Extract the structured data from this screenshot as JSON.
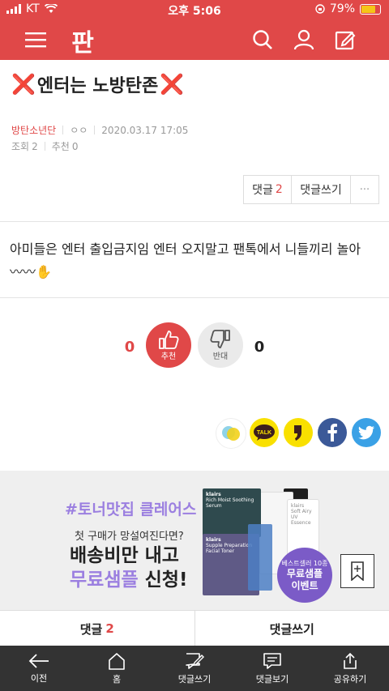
{
  "status_bar": {
    "carrier": "KT",
    "time": "오후 5:06",
    "battery": "79%",
    "battery_level": 0.79
  },
  "header": {
    "logo": "판",
    "icons": [
      "menu-icon",
      "search-icon",
      "user-icon",
      "write-icon"
    ]
  },
  "post": {
    "title_mark": "❌",
    "title": "엔터는 노방탄존",
    "board": "방탄소년단",
    "author": "ㅇㅇ",
    "date": "2020.03.17 17:05",
    "views_label": "조회",
    "views": "2",
    "likes_label": "추천",
    "likes": "0",
    "content_line1": "아미들은 엔터 출입금지임 엔터 오지말고 팬톡에서 니들끼리 놀아",
    "content_line2": "〰〰✋"
  },
  "comment_buttons": {
    "comments_label": "댓글",
    "comments_count": "2",
    "write_label": "댓글쓰기",
    "more_label": "···"
  },
  "vote": {
    "up_count": "0",
    "up_label": "추천",
    "down_count": "0",
    "down_label": "반대"
  },
  "share": {
    "icons": [
      "kakaostory-icon",
      "kakaotalk-icon",
      "story-icon",
      "facebook-icon",
      "twitter-icon"
    ],
    "talk_label": "TALK"
  },
  "ad": {
    "headline": "#토너맛집 클레어스",
    "question": "첫 구매가 망설여진다면?",
    "line1": "배송비만 내고",
    "line2_highlight": "무료샘플",
    "line2_rest": " 신청!",
    "badge_small": "베스트셀러 10종",
    "badge_line1": "무료샘플",
    "badge_line2": "이벤트",
    "brand": "klairs",
    "pkg1": "Rich Moist Soothing Serum",
    "pkg2": "Supple Preparation Facial Toner",
    "pkg3": "Soft Airy UV Essence"
  },
  "bottom_comment_bar": {
    "comments_label": "댓글",
    "comments_count": "2",
    "write_label": "댓글쓰기"
  },
  "bottom_nav": [
    {
      "label": "이전",
      "icon": "back-arrow-icon"
    },
    {
      "label": "홈",
      "icon": "home-icon"
    },
    {
      "label": "댓글쓰기",
      "icon": "comment-write-icon"
    },
    {
      "label": "댓글보기",
      "icon": "comment-view-icon"
    },
    {
      "label": "공유하기",
      "icon": "share-icon"
    }
  ],
  "colors": {
    "brand_red": "#e04848",
    "ad_purple": "#9b7fe0",
    "nav_dark": "#333333"
  }
}
